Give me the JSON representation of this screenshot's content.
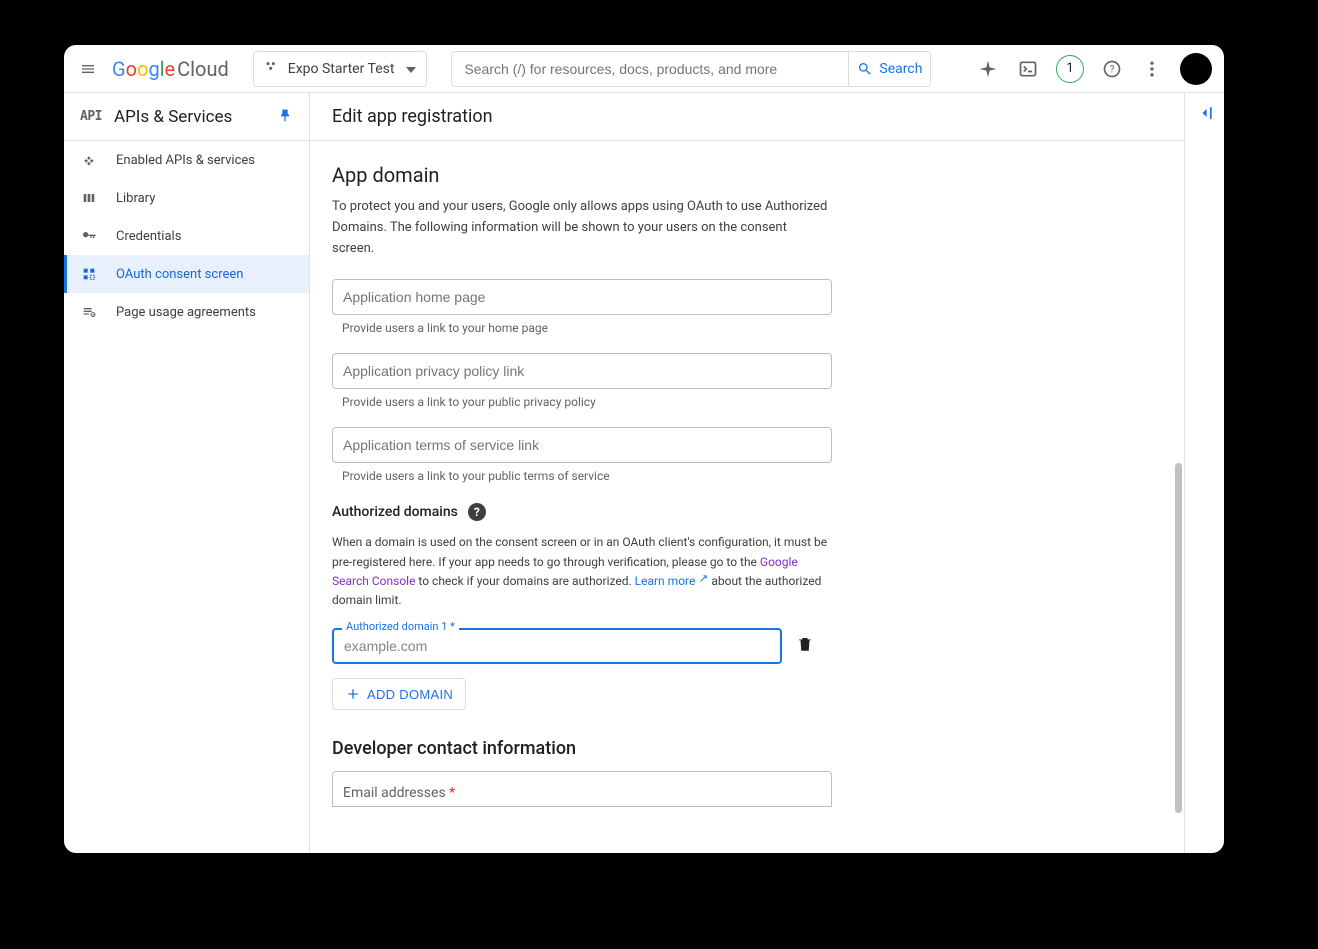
{
  "header": {
    "logo_word": "Google",
    "logo_suffix": "Cloud",
    "project_name": "Expo Starter Test",
    "search_placeholder": "Search (/) for resources, docs, products, and more",
    "search_button": "Search",
    "trial_badge": "1"
  },
  "sidebar": {
    "section_title": "APIs & Services",
    "items": [
      {
        "label": "Enabled APIs & services"
      },
      {
        "label": "Library"
      },
      {
        "label": "Credentials"
      },
      {
        "label": "OAuth consent screen"
      },
      {
        "label": "Page usage agreements"
      }
    ]
  },
  "page": {
    "title": "Edit app registration",
    "app_domain": {
      "heading": "App domain",
      "desc": "To protect you and your users, Google only allows apps using OAuth to use Authorized Domains. The following information will be shown to your users on the consent screen.",
      "home_placeholder": "Application home page",
      "home_helper": "Provide users a link to your home page",
      "privacy_placeholder": "Application privacy policy link",
      "privacy_helper": "Provide users a link to your public privacy policy",
      "tos_placeholder": "Application terms of service link",
      "tos_helper": "Provide users a link to your public terms of service"
    },
    "authorized": {
      "heading": "Authorized domains",
      "desc_pre": "When a domain is used on the consent screen or in an OAuth client's configuration, it must be pre-registered here. If your app needs to go through verification, please go to the ",
      "link_console": "Google Search Console",
      "desc_mid": " to check if your domains are authorized. ",
      "link_learn": "Learn more",
      "desc_post": " about the authorized domain limit.",
      "field_label": "Authorized domain 1",
      "field_placeholder": "example.com",
      "add_button": "ADD DOMAIN"
    },
    "developer": {
      "heading": "Developer contact information",
      "email_label": "Email addresses"
    }
  }
}
